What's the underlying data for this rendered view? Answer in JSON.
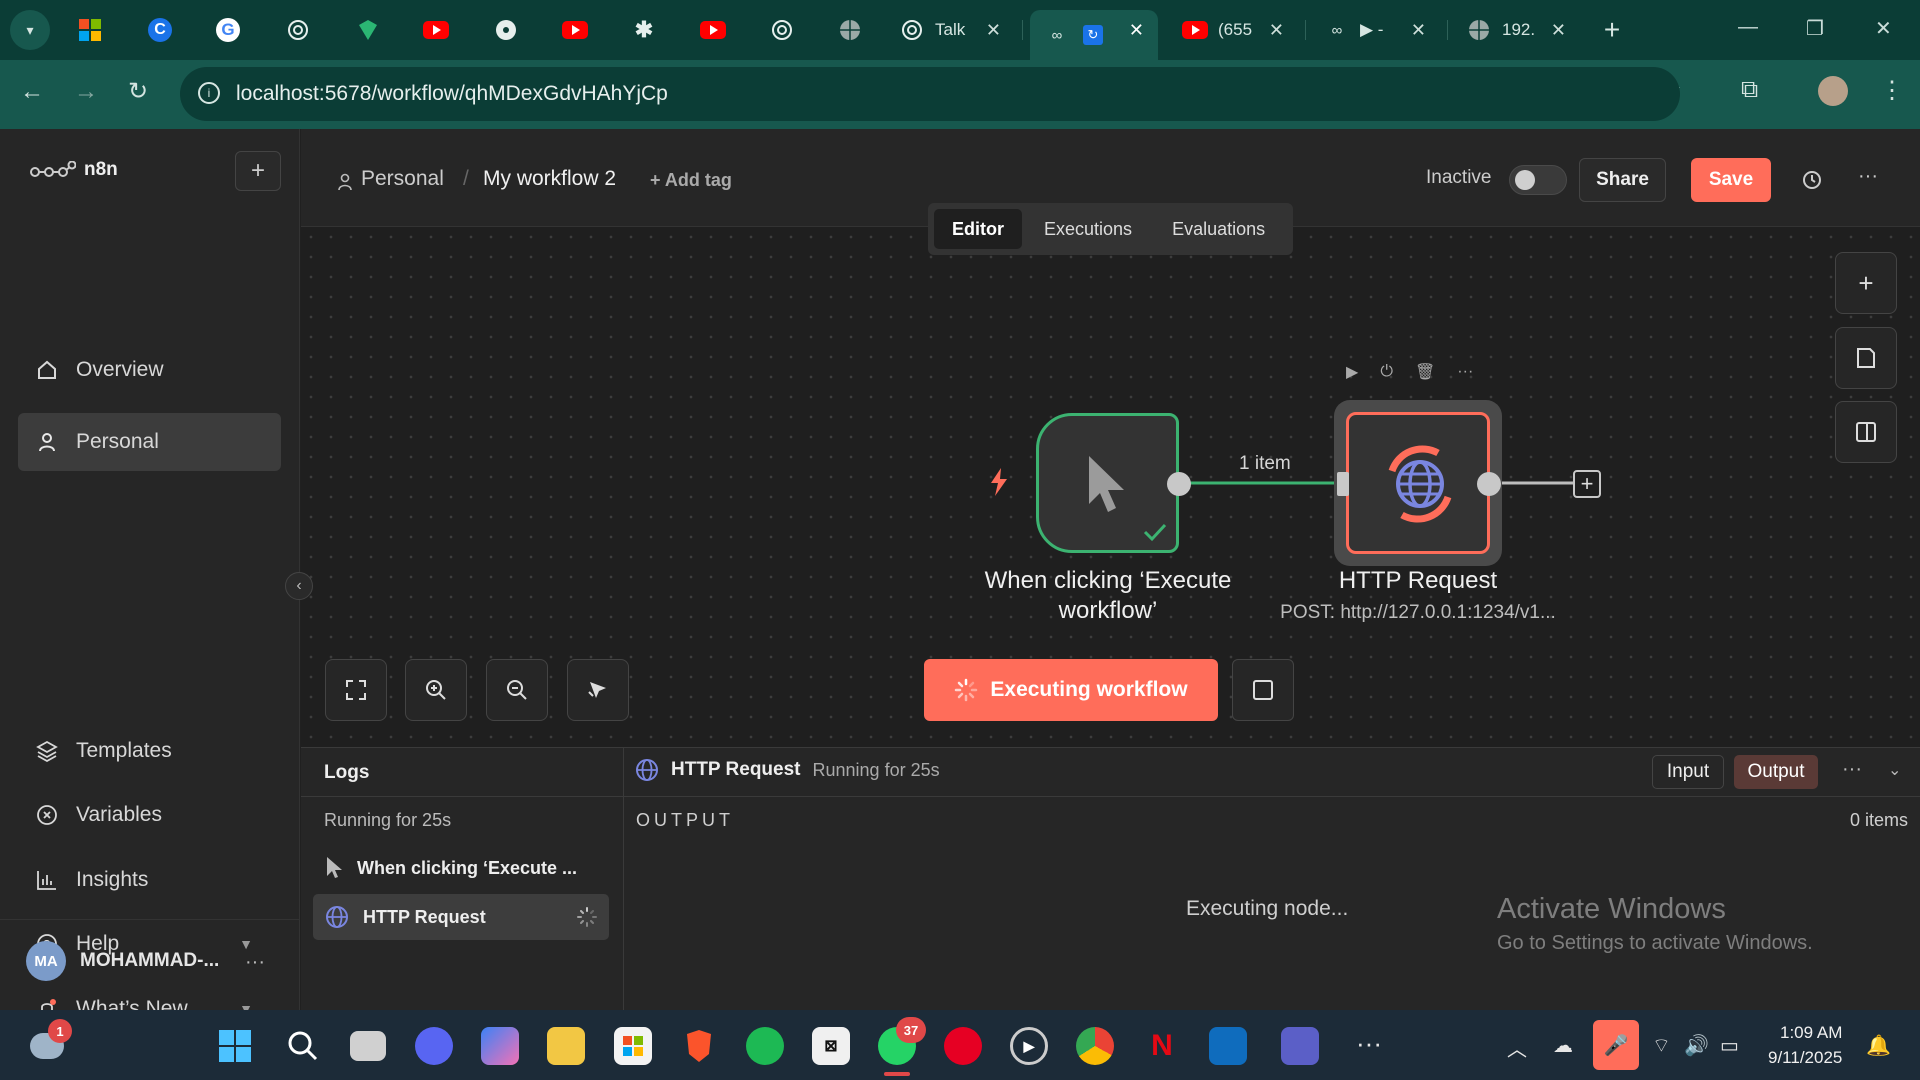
{
  "browser": {
    "tabs": [
      {
        "icon": "microsoft-icon"
      },
      {
        "icon": "copilot-c-icon"
      },
      {
        "icon": "google-icon"
      },
      {
        "icon": "chatgpt-icon"
      },
      {
        "icon": "shield-icon"
      },
      {
        "icon": "youtube-icon"
      },
      {
        "icon": "gemini-icon"
      },
      {
        "icon": "youtube-icon"
      },
      {
        "icon": "asterisk-icon"
      },
      {
        "icon": "youtube-icon"
      },
      {
        "icon": "chatgpt-icon"
      },
      {
        "icon": "globe-icon"
      },
      {
        "icon": "chatgpt-icon",
        "title": "Talk"
      },
      {
        "icon": "n8n-icon",
        "title": "",
        "active": true
      },
      {
        "icon": "youtube-icon",
        "title": "(655"
      },
      {
        "icon": "n8n-icon",
        "title": "▶ -"
      },
      {
        "icon": "globe-icon",
        "title": "192."
      }
    ],
    "new_tab": "+",
    "url": "localhost:5678/workflow/qhMDexGdvHAhYjCp"
  },
  "sidebar": {
    "brand": "n8n",
    "add": "+",
    "nav_top": [
      {
        "label": "Overview",
        "icon": "home-icon"
      },
      {
        "label": "Personal",
        "icon": "user-icon",
        "selected": true
      }
    ],
    "nav_bottom": [
      {
        "label": "Templates",
        "icon": "templates-icon"
      },
      {
        "label": "Variables",
        "icon": "variables-icon"
      },
      {
        "label": "Insights",
        "icon": "insights-icon"
      },
      {
        "label": "Help",
        "icon": "help-icon",
        "expandable": true
      },
      {
        "label": "What’s New",
        "icon": "bell-icon",
        "expandable": true
      }
    ],
    "user": {
      "initials": "MA",
      "name": "MOHAMMAD-..."
    }
  },
  "header": {
    "project": "Personal",
    "separator": "/",
    "workflow_name": "My workflow 2",
    "add_tag": "+ Add tag",
    "status": "Inactive",
    "share": "Share",
    "save": "Save",
    "tabs": [
      "Editor",
      "Executions",
      "Evaluations"
    ],
    "active_tab": "Editor"
  },
  "canvas": {
    "trigger_node": {
      "label": "When clicking ‘Execute workflow’"
    },
    "connection_label": "1 item",
    "http_node": {
      "label": "HTTP Request",
      "subtitle": "POST: http://127.0.0.1:1234/v1..."
    },
    "execute_button": "Executing workflow",
    "accent": "#ff6d5a",
    "success": "#3cb371"
  },
  "logs": {
    "title": "Logs",
    "running": "Running for 25s",
    "entries": [
      {
        "label": "When clicking ‘Execute ...",
        "icon": "cursor-icon"
      },
      {
        "label": "HTTP Request",
        "icon": "globe-icon",
        "selected": true
      }
    ],
    "detail_node": "HTTP Request",
    "detail_status": "Running for 25s",
    "input_tab": "Input",
    "output_tab": "Output",
    "output_label": "OUTPUT",
    "item_count": "0 items",
    "executing": "Executing node..."
  },
  "watermark": {
    "line1": "Activate Windows",
    "line2": "Go to Settings to activate Windows."
  },
  "taskbar": {
    "notification_badge": "1",
    "whatsapp_badge": "37",
    "time": "1:09 AM",
    "date": "9/11/2025"
  }
}
